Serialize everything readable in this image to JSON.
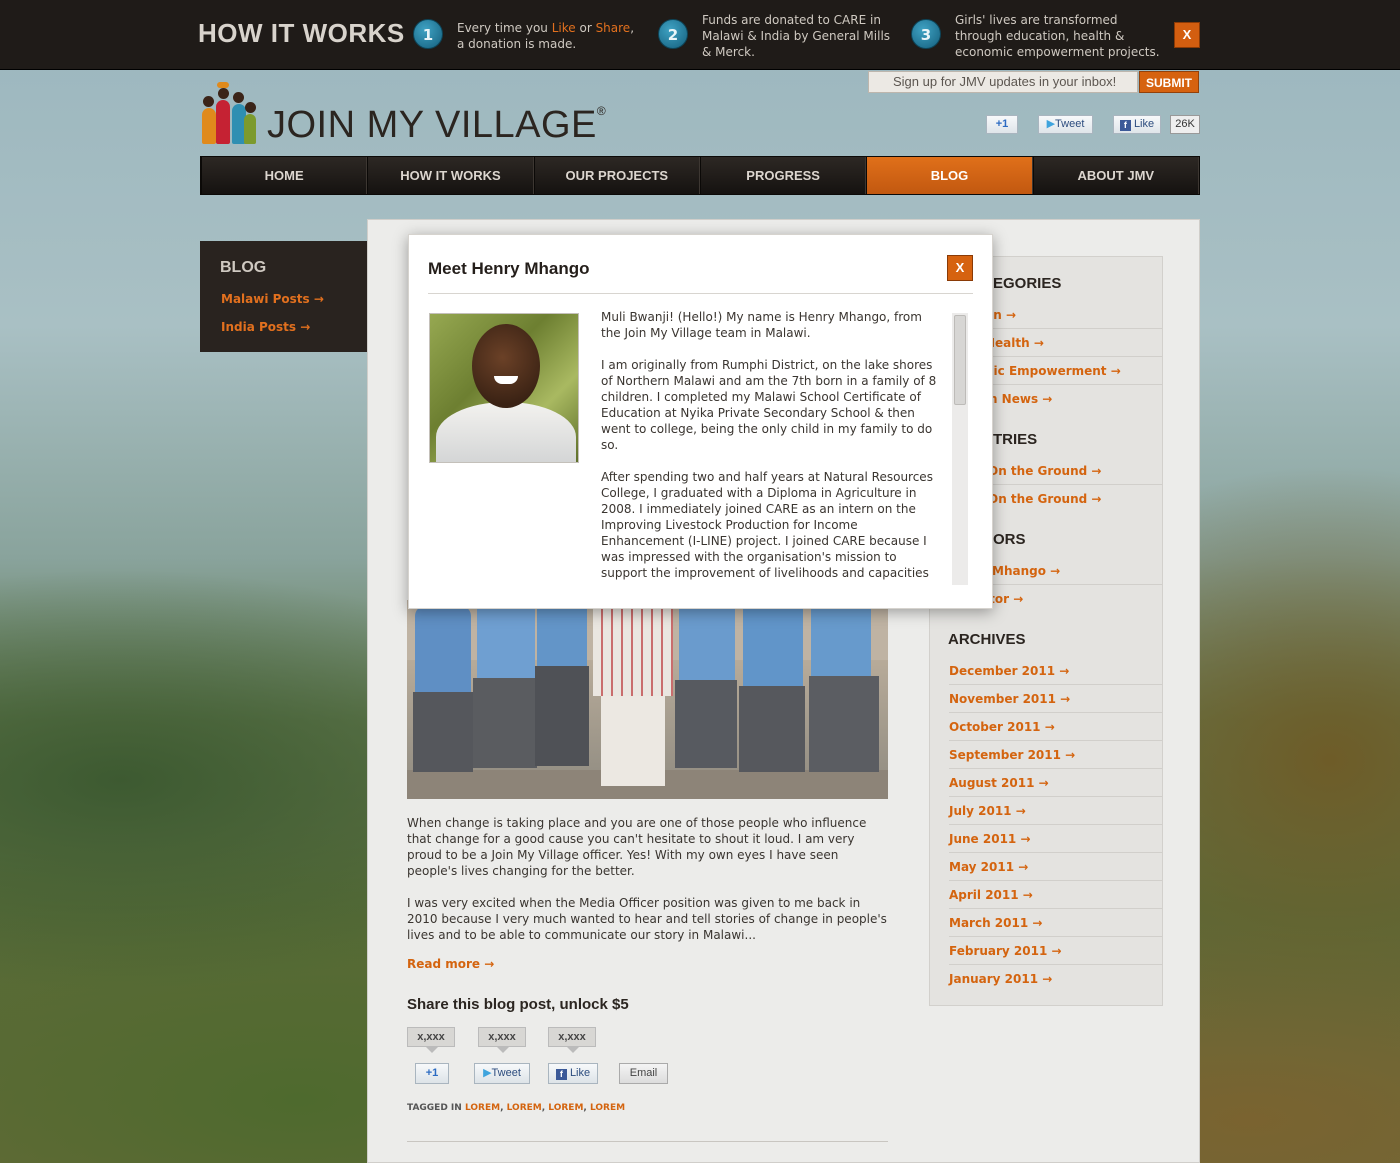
{
  "top_strip": {
    "title": "HOW IT WORKS",
    "steps": [
      {
        "num": "1",
        "pre": "Every time you ",
        "like": "Like",
        "mid": " or ",
        "share": "Share",
        "post": ",",
        "line2": "a donation is made."
      },
      {
        "num": "2",
        "line1": "Funds are donated to CARE in",
        "line2": "Malawi & India by General Mills",
        "line3": "& Merck."
      },
      {
        "num": "3",
        "line1": "Girls' lives are transformed",
        "line2": "through education, health &",
        "line3": "economic empowerment projects."
      }
    ],
    "close": "X"
  },
  "header": {
    "signup_placeholder": "Sign up for JMV updates in your inbox!",
    "submit": "SUBMIT",
    "brand": "JOIN MY VILLAGE",
    "brand_mark": "®",
    "social": {
      "plus": "+1",
      "tweet": "Tweet",
      "like": "Like",
      "like_count": "26K"
    }
  },
  "nav": [
    "HOME",
    "HOW IT WORKS",
    "OUR PROJECTS",
    "PROGRESS",
    "BLOG",
    "ABOUT JMV"
  ],
  "nav_active": 4,
  "blog_box": {
    "title": "BLOG",
    "links": [
      "Malawi Posts →",
      "India Posts →"
    ]
  },
  "sidebar": {
    "categories_head": "EGORIES",
    "categories": [
      "on →",
      "Health →",
      "nic Empowerment →",
      "m News →"
    ],
    "countries_head": "TRIES",
    "countries": [
      "On the Ground →",
      "On the Ground →"
    ],
    "authors_head": "ORS",
    "authors": [
      "Mhango →",
      "itor →"
    ],
    "archives_head": "ARCHIVES",
    "archives": [
      "December 2011 →",
      "November 2011 →",
      "October 2011 →",
      "September 2011 →",
      "August 2011 →",
      "July 2011 →",
      "June 2011 →",
      "May 2011 →",
      "April 2011 →",
      "March 2011 →",
      "February 2011 →",
      "January 2011 →"
    ]
  },
  "post": {
    "para1": "When change is taking place and you are one of those people who influence that change for a good cause you can't hesitate to shout it loud. I am very proud to be a Join My Village officer. Yes! With my own eyes I have seen people's lives changing for the better.",
    "para2": "I was very excited when the Media Officer position was given to me back in 2010 because I very much wanted to hear and tell stories of change in people's lives and to be able to communicate our story in Malawi...",
    "read_more": "Read more →",
    "share_heading": "Share this blog post, unlock $5",
    "counts": [
      "x,xxx",
      "x,xxx",
      "x,xxx"
    ],
    "share_buttons": {
      "plus": "+1",
      "tweet": "Tweet",
      "like": "Like",
      "email": "Email"
    },
    "tagged_label": "TAGGED IN ",
    "tags": [
      "LOREM",
      "LOREM",
      "LOREM",
      "LOREM"
    ]
  },
  "modal": {
    "title": "Meet Henry Mhango",
    "close": "X",
    "paragraphs": [
      "Muli Bwanji! (Hello!) My name is Henry Mhango, from the Join My Village team in Malawi.",
      "I am originally from Rumphi District, on the lake shores of Northern Malawi and am the 7th born in a family of 8 children. I completed my Malawi School Certificate of Education at Nyika Private Secondary School & then went to college, being the only child in my family to do so.",
      "After spending two and half years at Natural Resources College, I graduated with a Diploma in Agriculture in 2008. I immediately joined CARE as an intern on the Improving Livestock Production for Income Enhancement (I-LINE) project. I joined CARE because I was impressed with the organisation's mission to support the improvement of livelihoods and capacities of the poor and marginalised."
    ]
  },
  "colors": {
    "accent": "#d6620f",
    "dark": "#1f1b18",
    "step_blue": "#1f7da0"
  }
}
